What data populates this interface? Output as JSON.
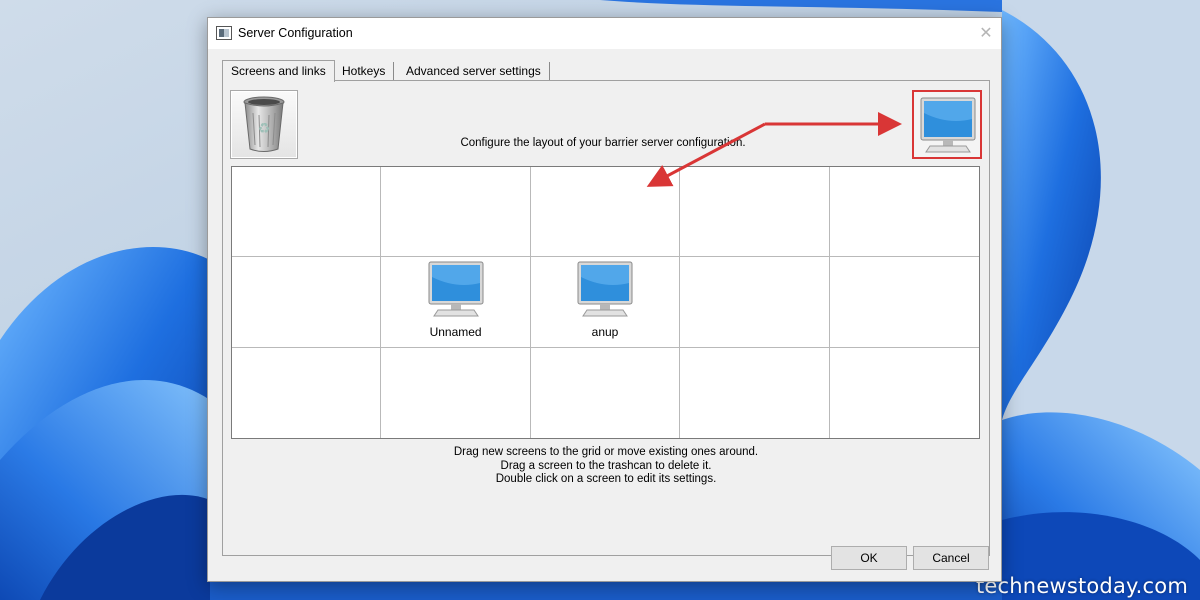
{
  "window": {
    "title": "Server Configuration",
    "close_glyph": "✕"
  },
  "tabs": [
    {
      "label": "Screens and links",
      "active": true
    },
    {
      "label": "Hotkeys",
      "active": false
    },
    {
      "label": "Advanced server settings",
      "active": false
    }
  ],
  "layout": {
    "instruction": "Configure the layout of your barrier server configuration.",
    "trash_icon": "trash-can-icon",
    "new_screen_icon": "monitor-icon"
  },
  "grid": {
    "rows": 3,
    "columns": 5,
    "screens": [
      {
        "name": "Unnamed",
        "row": 2,
        "column": 2
      },
      {
        "name": "anup",
        "row": 2,
        "column": 3
      }
    ]
  },
  "help": {
    "line1": "Drag new screens to the grid or move existing ones around.",
    "line2": "Drag a screen to the trashcan to delete it.",
    "line3": "Double click on a screen to edit its settings."
  },
  "buttons": {
    "ok": "OK",
    "cancel": "Cancel"
  },
  "colors": {
    "annotation_red": "#d93636",
    "monitor_blue": "#2f8fdc"
  },
  "watermark": "technewstoday.com"
}
